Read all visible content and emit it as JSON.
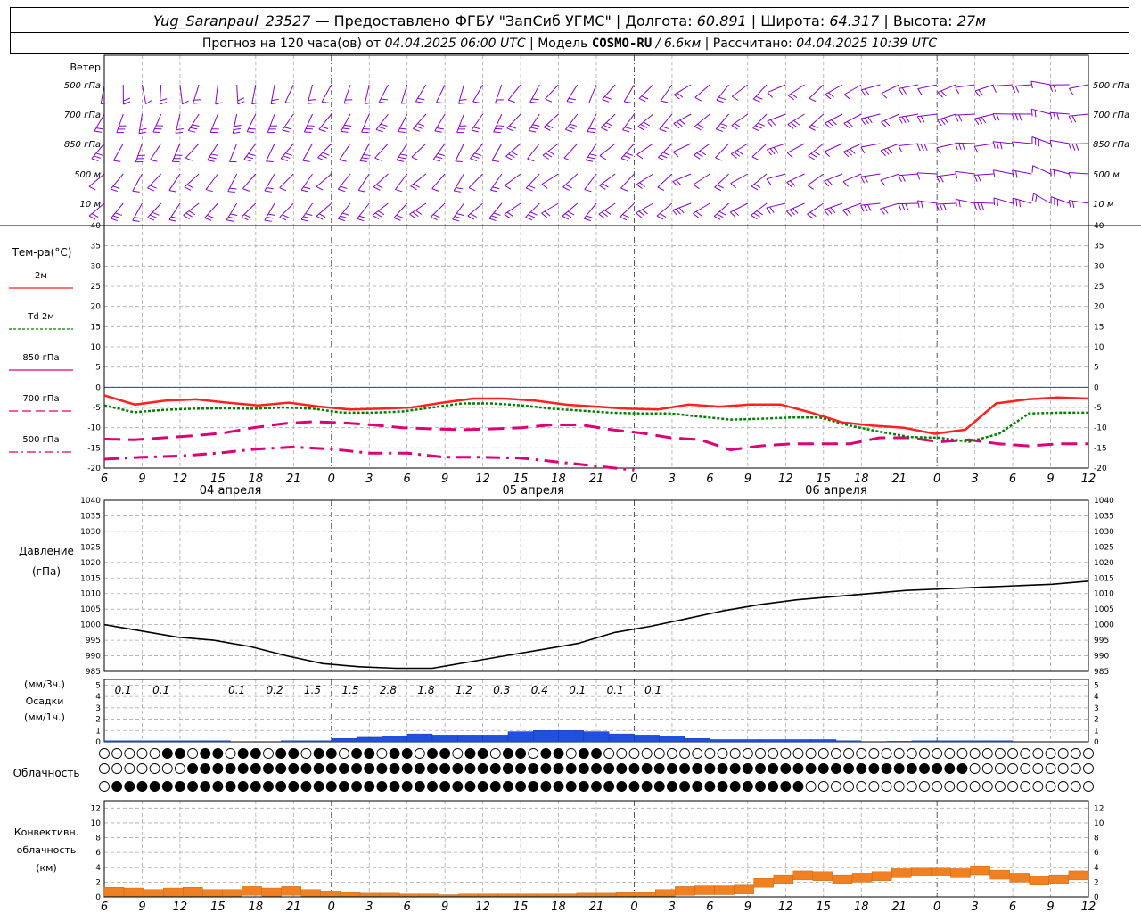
{
  "header": {
    "station": "Yug_Saranpaul_23527",
    "dash": " — ",
    "provider": "Предоставлено ФГБУ \"ЗапСиб УГМС\"",
    "lon_label": "Долгота:",
    "lon_value": "60.891",
    "lat_label": "Широта:",
    "lat_value": "64.317",
    "alt_label": "Высота:",
    "alt_value": "27м",
    "forecast_prefix": "Прогноз на 120 часа(ов) от",
    "forecast_time": "04.04.2025 06:00 UTC",
    "model_label": "Модель",
    "model_name": "COSMO-RU",
    "model_res": "/ 6.6км",
    "calc_label": "Рассчитано:",
    "calc_time": "04.04.2025 10:39 UTC"
  },
  "panels": {
    "wind": {
      "title": "Ветер",
      "levels": [
        "500 гПа",
        "700 гПа",
        "850 гПа",
        "500 м",
        "10 м"
      ],
      "color": "#8800cc"
    },
    "temp": {
      "title": "Тем-ра(°C)",
      "legend": [
        {
          "label": "2м",
          "color": "#ff2020",
          "style": "solid"
        },
        {
          "label": "Td 2м",
          "color": "#008000",
          "style": "dotted"
        },
        {
          "label": "850 гПа",
          "color": "#dd0077",
          "style": "solid-thin"
        },
        {
          "label": "700 гПа",
          "color": "#dd0077",
          "style": "longdash"
        },
        {
          "label": "500 гПа",
          "color": "#dd0077",
          "style": "dashdot"
        }
      ],
      "yticks": [
        "40",
        "35",
        "30",
        "25",
        "20",
        "15",
        "10",
        "5",
        "0",
        "-5",
        "-10",
        "-15",
        "-20"
      ]
    },
    "pressure": {
      "title1": "Давление",
      "title2": "(гПа)",
      "yticks": [
        "1040",
        "1035",
        "1030",
        "1025",
        "1020",
        "1015",
        "1010",
        "1005",
        "1000",
        "995",
        "990",
        "985"
      ]
    },
    "precip": {
      "title1": "(мм/3ч.)",
      "title2": "Осадки",
      "title3": "(мм/1ч.)",
      "yticks": [
        "5",
        "4",
        "3",
        "2",
        "1",
        "0"
      ],
      "labels_3h": [
        "0.1",
        "0.1",
        "",
        "0.1",
        "0.2",
        "1.5",
        "1.5",
        "2.8",
        "1.8",
        "1.2",
        "0.3",
        "0.4",
        "0.1",
        "0.1",
        "0.1"
      ],
      "color": "#2050e0"
    },
    "cloud": {
      "title": "Облачность"
    },
    "conv": {
      "title1": "Конвективн.",
      "title2": "облачность",
      "title3": "(км)",
      "yticks": [
        "12",
        "10",
        "8",
        "6",
        "4",
        "2",
        "0"
      ],
      "color": "#f08020"
    }
  },
  "x_axis": {
    "hour_labels": [
      "6",
      "9",
      "12",
      "15",
      "18",
      "21",
      "0",
      "3",
      "6",
      "9",
      "12",
      "15",
      "18",
      "21",
      "0",
      "3",
      "6",
      "9",
      "12",
      "15",
      "18",
      "21",
      "0",
      "3",
      "6",
      "9",
      "12"
    ],
    "day_labels": [
      "04 апреля",
      "05 апреля",
      "06 апреля"
    ]
  },
  "chart_data": {
    "type": "line",
    "x_unit": "hours from 04.04.2025 06:00 UTC",
    "x": [
      0,
      3,
      6,
      9,
      12,
      15,
      18,
      21,
      24,
      27,
      30,
      33,
      36,
      39,
      42,
      45,
      48,
      51,
      54,
      57,
      60,
      63,
      66,
      69,
      72,
      75,
      78
    ],
    "series": [
      {
        "name": "2м",
        "unit": "°C",
        "values": [
          -2,
          -4.3,
          -3.3,
          -3,
          -3.8,
          -4.5,
          -3.8,
          -4.8,
          -5.5,
          -5.3,
          -5,
          -3.8,
          -2.8,
          -2.8,
          -3.3,
          -4.3,
          -4.8,
          -5.3,
          -5.5,
          -4.3,
          -4.8,
          -4.3,
          -4.3,
          -6.3,
          -8.7,
          -9.5,
          -10,
          -11.5,
          -10.5,
          -4,
          -3,
          -2.5,
          -2.8
        ]
      },
      {
        "name": "Td 2м",
        "unit": "°C",
        "values": [
          -4.5,
          -6.2,
          -5.6,
          -5.3,
          -5.2,
          -5.3,
          -5.0,
          -5.3,
          -6.3,
          -6.3,
          -6.0,
          -5.0,
          -4.0,
          -4.0,
          -4.5,
          -5.3,
          -5.8,
          -6.3,
          -6.5,
          -6.5,
          -7.3,
          -8.0,
          -7.8,
          -7.5,
          -7.5,
          -9.5,
          -11,
          -12.3,
          -12.5,
          -13.5,
          -11.5,
          -6.5,
          -6.3,
          -6.3
        ]
      },
      {
        "name": "700 гПа",
        "unit": "°C",
        "values": [
          -12.8,
          -13,
          -12.5,
          -12,
          -11.3,
          -10,
          -9,
          -8.5,
          -8.8,
          -9.3,
          -10,
          -10.3,
          -10.5,
          -10.3,
          -10,
          -9.3,
          -9.3,
          -10.5,
          -11.3,
          -12.5,
          -13,
          -15.5,
          -14.5,
          -14,
          -14,
          -14,
          -12.5,
          -12.5,
          -13.5,
          -13,
          -14,
          -14.5,
          -14,
          -14
        ]
      },
      {
        "name": "500 гПа",
        "unit": "°C",
        "values": [
          -17.8,
          -17.3,
          -17,
          -16.3,
          -15.3,
          -14.8,
          -15.3,
          -16.3,
          -16.3,
          -17.3,
          -17.3,
          -17.5,
          -18.5,
          -19.5,
          -20.5
        ]
      },
      {
        "name": "Давление",
        "unit": "гПа",
        "values": [
          1000,
          998,
          996,
          995,
          993,
          990,
          987.5,
          986.5,
          986,
          986,
          988,
          990,
          992,
          994,
          997.5,
          999.5,
          1002,
          1004.5,
          1006.5,
          1008,
          1009,
          1010,
          1011,
          1011.5,
          1012,
          1012.5,
          1013,
          1014
        ]
      },
      {
        "name": "Осадки",
        "unit": "мм/1ч",
        "values": [
          0.1,
          0.1,
          0.1,
          0.1,
          0.1,
          0.0,
          0.0,
          0.1,
          0.1,
          0.3,
          0.4,
          0.5,
          0.7,
          0.6,
          0.6,
          0.6,
          0.9,
          1.0,
          1.0,
          0.9,
          0.7,
          0.6,
          0.5,
          0.3,
          0.2,
          0.2,
          0.2,
          0.2,
          0.2,
          0.1,
          0.0,
          0.05,
          0.1,
          0.1,
          0.1,
          0.1
        ]
      },
      {
        "name": "Конвективная облачность",
        "unit": "км",
        "values": [
          1.3,
          1.2,
          1.0,
          1.2,
          1.3,
          1.0,
          1.0,
          1.4,
          1.2,
          1.4,
          1.0,
          0.8,
          0.6,
          0.5,
          0.5,
          0.4,
          0.4,
          0.3,
          0.4,
          0.4,
          0.4,
          0.4,
          0.4,
          0.4,
          0.5,
          0.5,
          0.6,
          0.6,
          1.0,
          1.4,
          1.5,
          1.5,
          1.6,
          2.5,
          3.0,
          3.5,
          3.4,
          3.0,
          3.2,
          3.4,
          3.8,
          4.0,
          4.0,
          3.8,
          4.2,
          3.6,
          3.2,
          2.8,
          3.0,
          3.5
        ]
      }
    ]
  }
}
